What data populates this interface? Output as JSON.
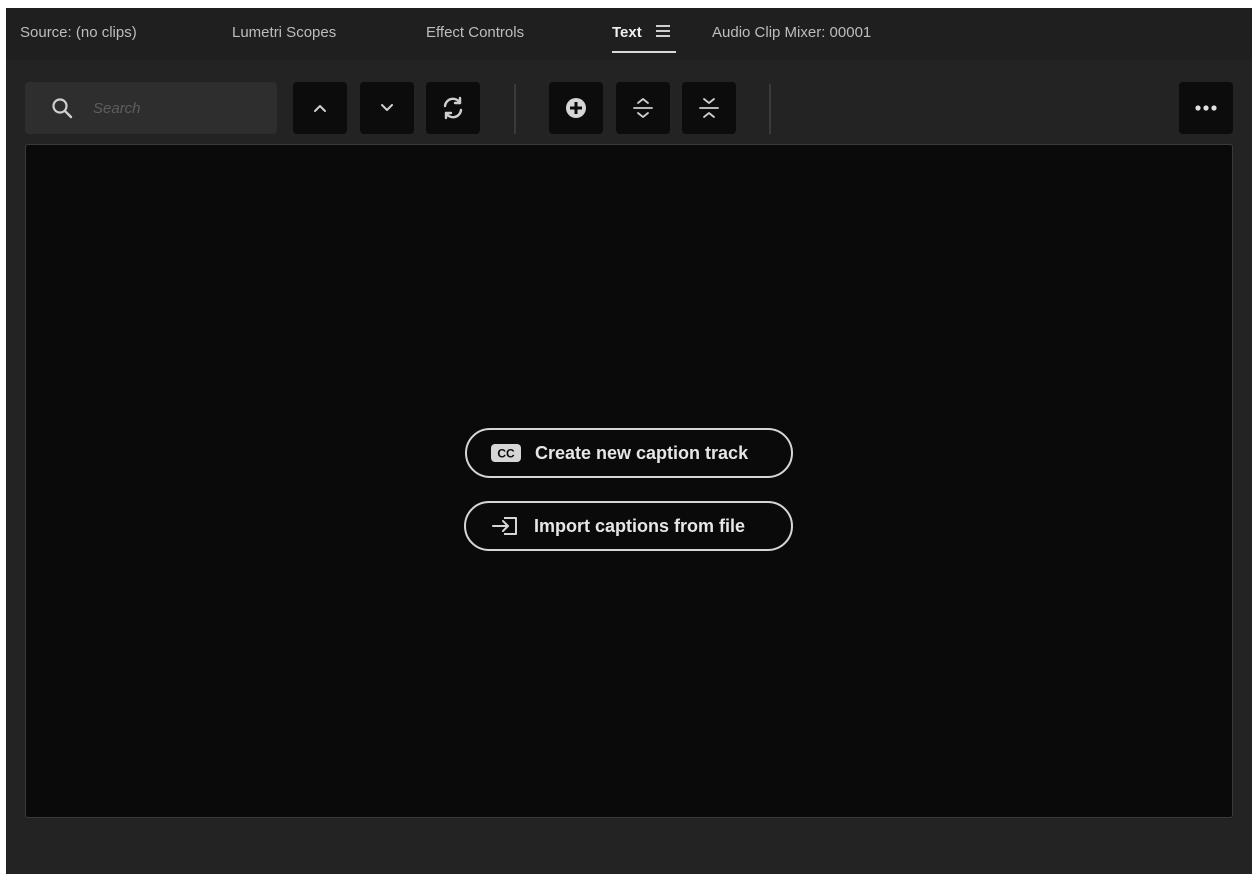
{
  "tabs": [
    {
      "label": "Source: (no clips)",
      "active": false
    },
    {
      "label": "Lumetri Scopes",
      "active": false
    },
    {
      "label": "Effect Controls",
      "active": false
    },
    {
      "label": "Text",
      "active": true
    },
    {
      "label": "Audio Clip Mixer: 00001",
      "active": false
    }
  ],
  "search": {
    "placeholder": "Search",
    "value": ""
  },
  "toolbar": {
    "icons": [
      "chevron-up-icon",
      "chevron-down-icon",
      "refresh-icon",
      "add-circle-icon",
      "expand-icon",
      "collapse-icon",
      "more-icon"
    ]
  },
  "actions": {
    "create_caption_label": "Create new caption track",
    "create_caption_icon": "closed-captions-icon",
    "import_captions_label": "Import captions from file",
    "import_captions_icon": "import-icon"
  },
  "colors": {
    "panel_bg": "#232323",
    "content_bg": "#0a0a0a",
    "button_bg": "#0c0c0c",
    "text_primary": "#e6e6e6"
  }
}
